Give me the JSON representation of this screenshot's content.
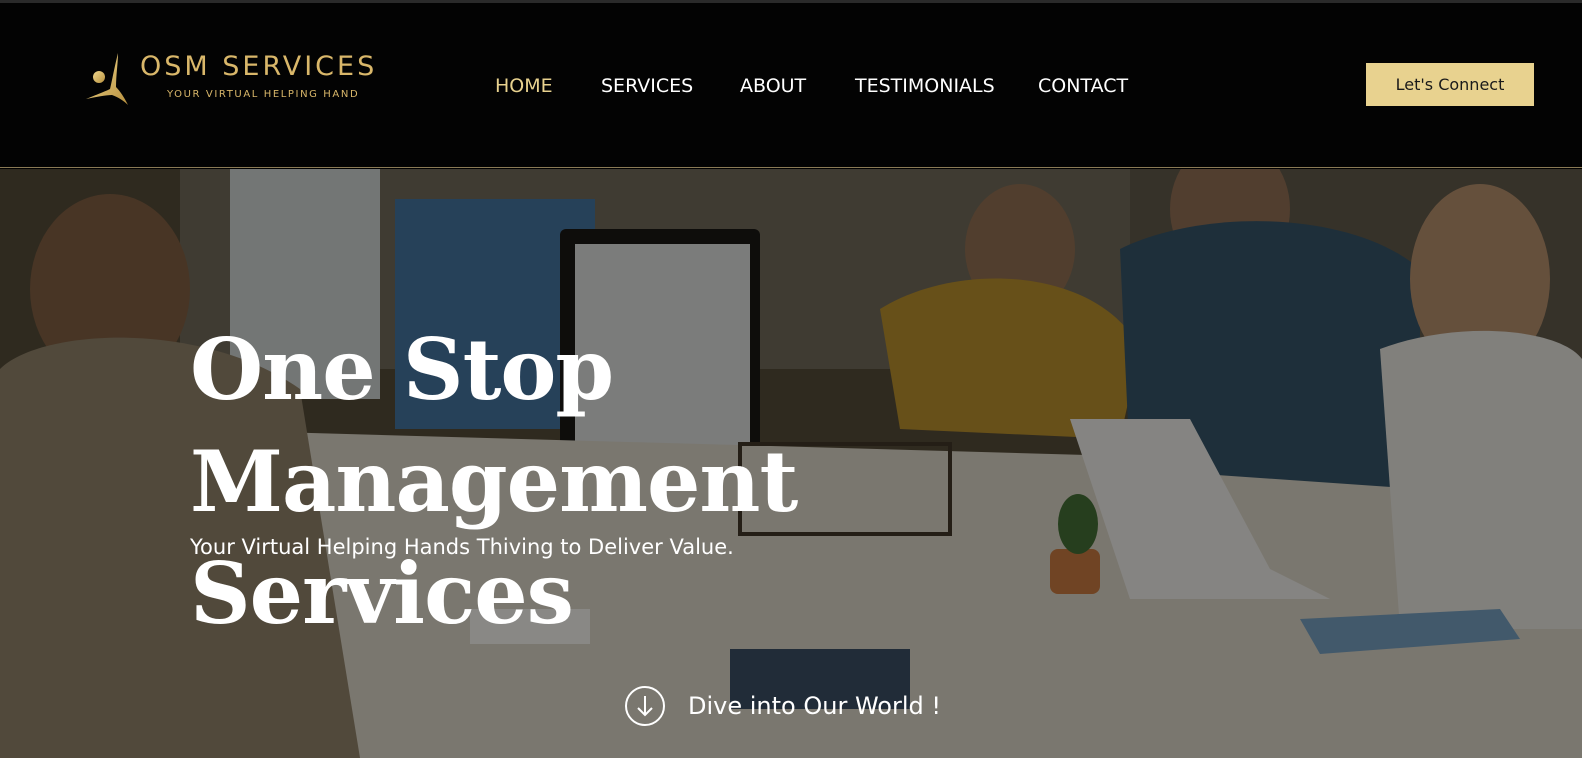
{
  "header": {
    "logo_title": "OSM SERVICES",
    "logo_subtitle": "YOUR VIRTUAL HELPING HAND",
    "logo_icon": "person-reaching-icon",
    "nav": [
      {
        "label": "HOME",
        "active": true
      },
      {
        "label": "SERVICES",
        "active": false
      },
      {
        "label": "ABOUT",
        "active": false
      },
      {
        "label": "TESTIMONIALS",
        "active": false
      },
      {
        "label": "CONTACT",
        "active": false
      }
    ],
    "cta_label": "Let's Connect"
  },
  "hero": {
    "title_line1": "One Stop Management",
    "title_line2": "Services",
    "subtitle": "Your Virtual Helping Hands Thiving to Deliver Value.",
    "scroll_label": "Dive into Our World !",
    "scroll_icon": "arrow-down-circle-icon"
  },
  "colors": {
    "accent_gold": "#e8d28f",
    "logo_gold": "#d9b76a",
    "header_bg": "#030303",
    "text_white": "#ffffff"
  }
}
